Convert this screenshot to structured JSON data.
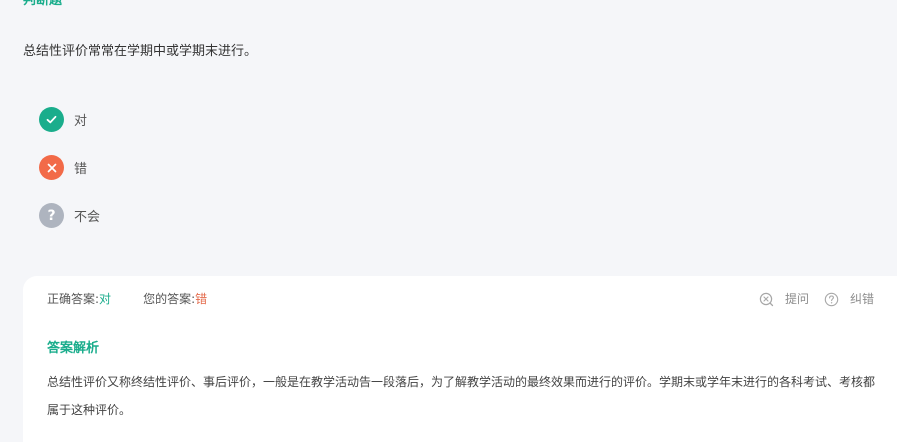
{
  "question": {
    "type_label": "判断题",
    "stem": "总结性评价常常在学期中或学期末进行。"
  },
  "options": [
    {
      "label": "对",
      "icon": "check-icon"
    },
    {
      "label": "错",
      "icon": "cross-icon"
    },
    {
      "label": "不会",
      "icon": "question-icon",
      "glyph": "?"
    }
  ],
  "answer": {
    "correct_label": "正确答案:",
    "correct_value": "对",
    "yours_label": "您的答案:",
    "yours_value": "错"
  },
  "tools": {
    "ask_label": "提问",
    "report_label": "纠错"
  },
  "analysis": {
    "title": "答案解析",
    "text": "总结性评价又称终结性评价、事后评价，一般是在教学活动告一段落后，为了解教学活动的最终效果而进行的评价。学期末或学年末进行的各科考试、考核都属于这种评价。"
  },
  "colors": {
    "accent": "#1aad8c",
    "wrong": "#f26a48",
    "neutral": "#aeb4bf",
    "background": "#f5f6f9"
  }
}
